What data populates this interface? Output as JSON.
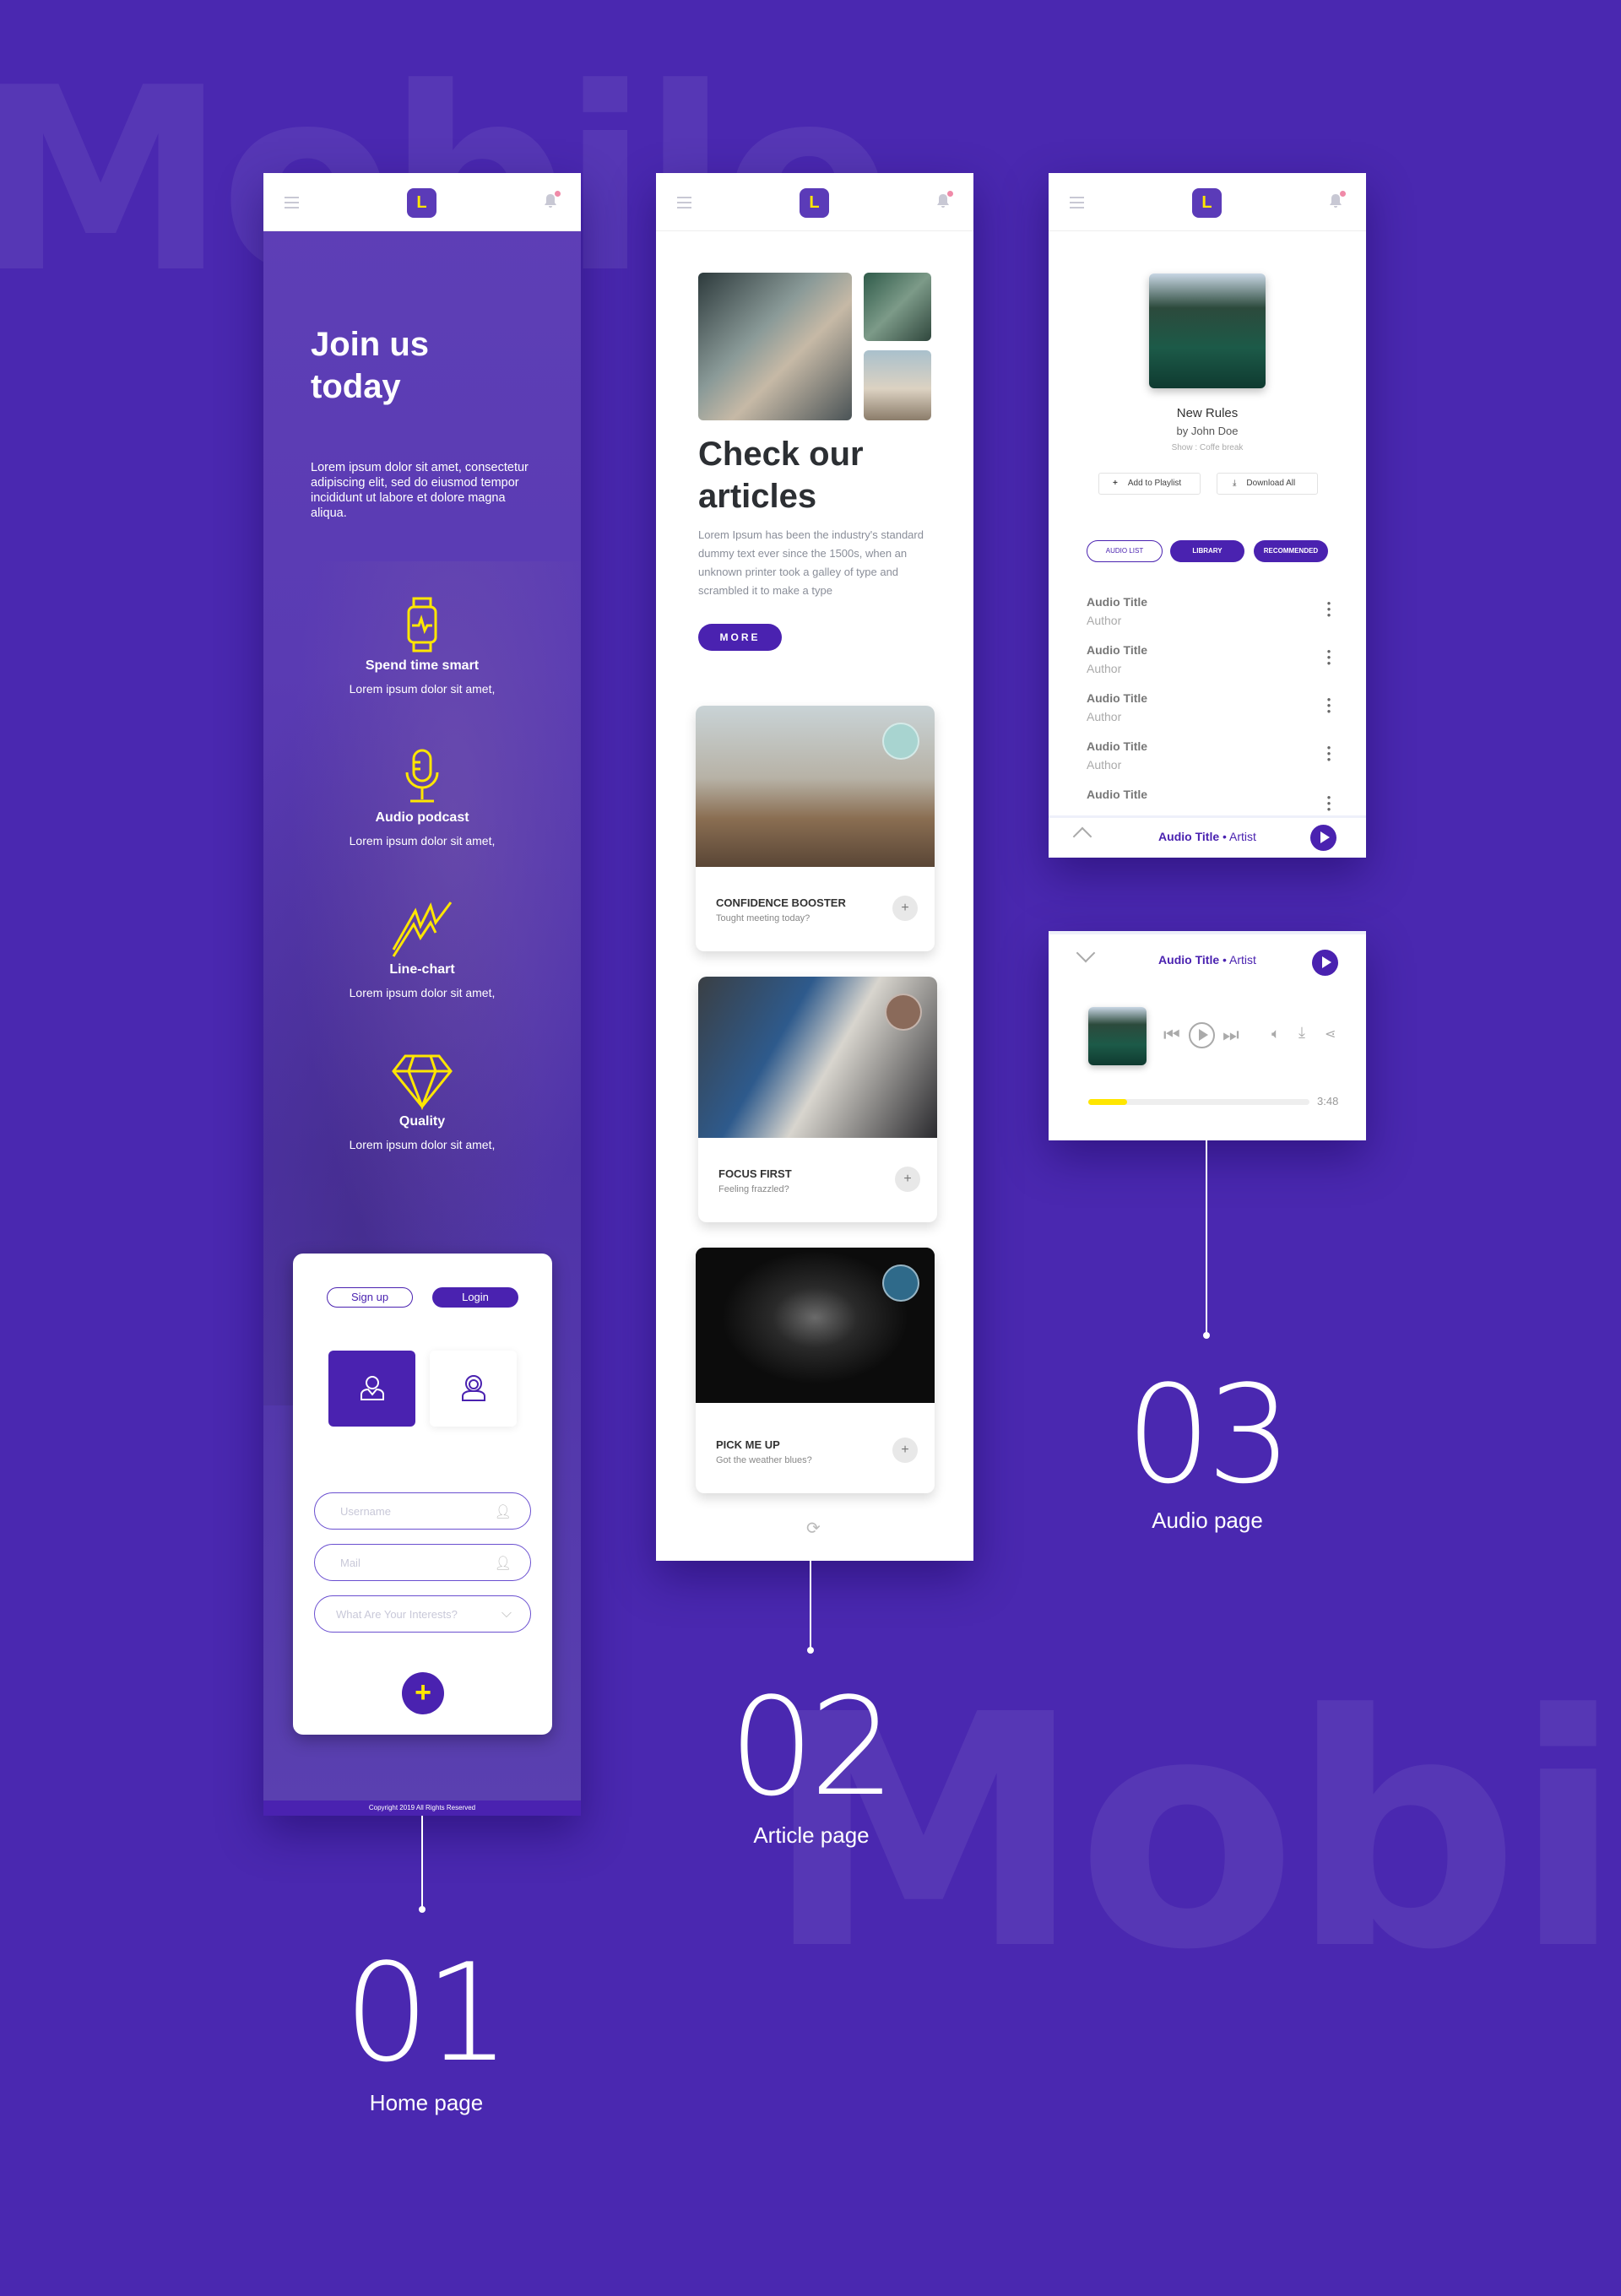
{
  "watermark": "Mobile",
  "colors": {
    "background": "#4a28b0",
    "primary": "#4a22b0",
    "accent": "#ffe600",
    "notification": "#f08aa8"
  },
  "header": {
    "logo_letter": "L",
    "menu_icon": "hamburger-icon",
    "bell_icon": "bell-icon"
  },
  "sections": [
    {
      "number": "01",
      "label": "Home page"
    },
    {
      "number": "02",
      "label": "Article page"
    },
    {
      "number": "03",
      "label": "Audio page"
    }
  ],
  "home": {
    "title_line1": "Join us",
    "title_line2": "today",
    "intro": "Lorem ipsum dolor sit amet, consectetur adipiscing elit, sed do eiusmod tempor  incididunt ut labore et dolore magna aliqua.",
    "features": [
      {
        "icon": "smartwatch-icon",
        "title": "Spend time smart",
        "text": "Lorem ipsum dolor sit amet,"
      },
      {
        "icon": "microphone-icon",
        "title": "Audio podcast",
        "text": "Lorem ipsum dolor sit amet,"
      },
      {
        "icon": "line-chart-icon",
        "title": "Line-chart",
        "text": "Lorem ipsum dolor sit amet,"
      },
      {
        "icon": "diamond-icon",
        "title": "Quality",
        "text": "Lorem ipsum dolor sit amet,"
      }
    ],
    "form": {
      "signup": "Sign up",
      "login": "Login",
      "username_placeholder": "Username",
      "mail_placeholder": "Mail",
      "interests_placeholder": "What Are Your Interests?",
      "submit": "+"
    },
    "copyright": "Copyright 2019 All Rights Reserved"
  },
  "articles": {
    "title_line1": "Check our",
    "title_line2": "articles",
    "text": "Lorem Ipsum has been the industry's standard dummy text ever since the 1500s, when an unknown printer took a galley of type and scrambled it to make a type",
    "more": "MORE",
    "cards": [
      {
        "title": "CONFIDENCE BOOSTER",
        "subtitle": "Tought meeting today?"
      },
      {
        "title": "FOCUS FIRST",
        "subtitle": "Feeling frazzled?"
      },
      {
        "title": "PICK ME UP",
        "subtitle": "Got the weather blues?"
      }
    ]
  },
  "audio": {
    "album_title": "New Rules",
    "by": "by John Doe",
    "show": "Show : Coffe break",
    "add_playlist": "Add to Playlist",
    "download_all": "Download All",
    "tabs": [
      "AUDIO LIST",
      "LIBRARY",
      "RECOMMENDED"
    ],
    "items": [
      {
        "title": "Audio Title",
        "author": "Author"
      },
      {
        "title": "Audio Title",
        "author": "Author"
      },
      {
        "title": "Audio Title",
        "author": "Author"
      },
      {
        "title": "Audio Title",
        "author": "Author"
      },
      {
        "title": "Audio Title",
        "author": ""
      }
    ],
    "now_playing": {
      "title": "Audio Title",
      "separator": " • ",
      "artist": "Artist"
    },
    "player": {
      "duration": "3:48",
      "progress_percent": 17.5
    }
  }
}
